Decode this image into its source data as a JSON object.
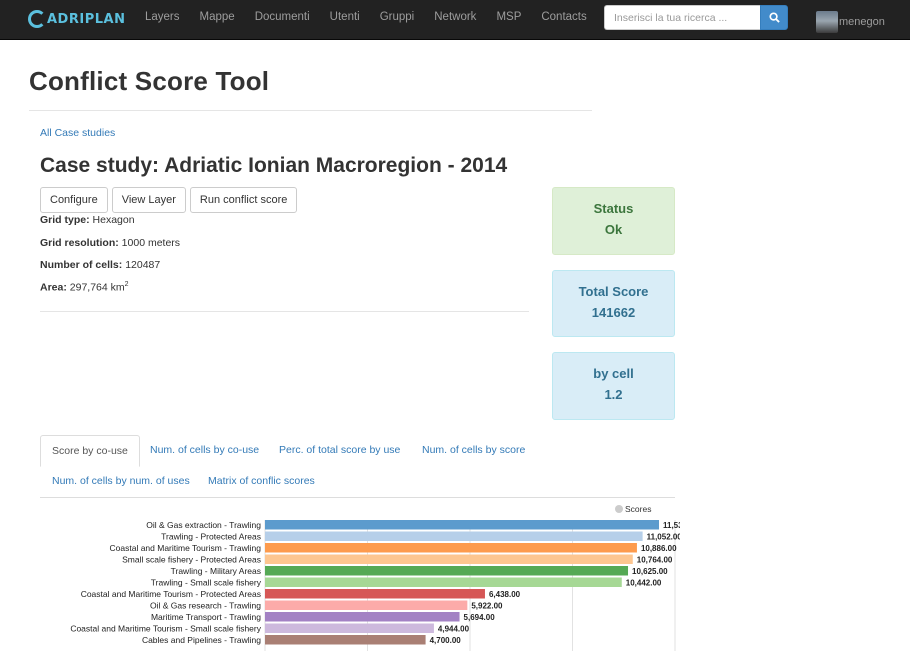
{
  "navbar": {
    "brand": "ADRIPLAN",
    "links": [
      "Layers",
      "Mappe",
      "Documenti",
      "Utenti",
      "Gruppi",
      "Network",
      "MSP",
      "Contacts"
    ],
    "search_placeholder": "Inserisci la tua ricerca ...",
    "username": "menegon"
  },
  "page": {
    "title": "Conflict Score Tool",
    "breadcrumb": "All Case studies",
    "case_title": "Case study: Adriatic Ionian Macroregion - 2014"
  },
  "buttons": {
    "configure": "Configure",
    "view_layer": "View Layer",
    "run": "Run conflict score"
  },
  "info": {
    "grid_type_label": "Grid type:",
    "grid_type_value": "Hexagon",
    "grid_res_label": "Grid resolution:",
    "grid_res_value": "1000 meters",
    "cells_label": "Number of cells:",
    "cells_value": "120487",
    "area_label": "Area:",
    "area_value": "297,764 km",
    "area_sup": "2"
  },
  "stats": {
    "status_label": "Status",
    "status_value": "Ok",
    "total_label": "Total Score",
    "total_value": "141662",
    "cell_label": "by cell",
    "cell_value": "1.2"
  },
  "tabs": [
    "Score by co-use",
    "Num. of cells by co-use",
    "Perc. of total score by use",
    "Num. of cells by score",
    "Num. of cells by num. of uses",
    "Matrix of conflic scores"
  ],
  "colors": {
    "navbar": "#222222",
    "link": "#337ab7",
    "status_ok_bg": "#dff0d8",
    "status_ok_text": "#3c763d",
    "info_bg": "#d9edf7",
    "info_text": "#31708f"
  },
  "chart_data": {
    "type": "bar",
    "orientation": "horizontal",
    "legend": [
      "Scores"
    ],
    "legend_position": "top-right",
    "grid": true,
    "xlim": [
      0,
      12000
    ],
    "categories": [
      "Oil & Gas extraction - Trawling",
      "Trawling - Protected Areas",
      "Coastal and Maritime Tourism - Trawling",
      "Small scale fishery - Protected Areas",
      "Trawling - Military Areas",
      "Trawling - Small scale fishery",
      "Coastal and Maritime Tourism - Protected Areas",
      "Oil & Gas research - Trawling",
      "Maritime Transport - Trawling",
      "Coastal and Maritime Tourism - Small scale fishery",
      "Cables and Pipelines - Trawling"
    ],
    "values": [
      11532,
      11052,
      10886,
      10764,
      10625,
      10442,
      6438,
      5922,
      5694,
      4944,
      4700
    ],
    "value_labels": [
      "11,532.00",
      "11,052.00",
      "10,886.00",
      "10,764.00",
      "10,625.00",
      "10,442.00",
      "6,438.00",
      "5,922.00",
      "5,694.00",
      "4,944.00",
      "4,700.00"
    ],
    "bar_colors": [
      "#5c9bcd",
      "#b6cfe9",
      "#fd9b4d",
      "#fdc690",
      "#55a955",
      "#a6d895",
      "#d65756",
      "#fcaba9",
      "#a382c4",
      "#cdb9dd",
      "#a97f74"
    ]
  }
}
